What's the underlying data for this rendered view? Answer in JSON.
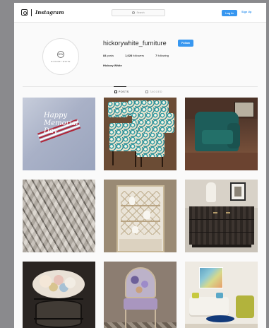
{
  "nav": {
    "logo": "Instagram",
    "search_placeholder": "Search",
    "login_label": "Log In",
    "signup_label": "Sign Up"
  },
  "profile": {
    "username": "hickorywhite_furniture",
    "follow_label": "Follow",
    "avatar_text": "HICKORY WHITE",
    "avatar_mark": "HW",
    "stats": {
      "posts_count": "84",
      "posts_label": "posts",
      "followers_count": "1,028",
      "followers_label": "followers",
      "following_count": "7",
      "following_label": "following"
    },
    "full_name": "Hickory White"
  },
  "tabs": {
    "posts": "POSTS",
    "tagged": "TAGGED"
  },
  "tiles": {
    "t1_line1": "Happy",
    "t1_line2": "Memorial",
    "t1_line3": "Day"
  },
  "colors": {
    "accent": "#3897f0",
    "page_bg": "#8a8a8d"
  }
}
